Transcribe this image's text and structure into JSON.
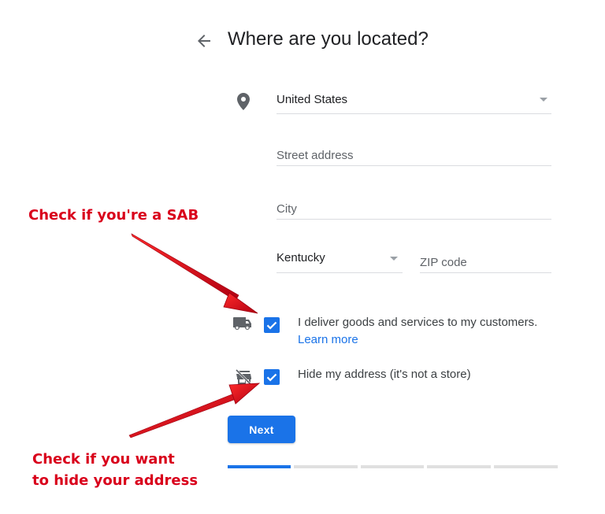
{
  "header": {
    "title": "Where are you located?"
  },
  "form": {
    "country": {
      "value": "United States"
    },
    "street": {
      "placeholder": "Street address"
    },
    "city": {
      "placeholder": "City"
    },
    "state": {
      "value": "Kentucky"
    },
    "zip": {
      "placeholder": "ZIP code"
    },
    "deliver": {
      "label": "I deliver goods and services to my customers.",
      "link": "Learn more",
      "checked": true
    },
    "hide_address": {
      "label": "Hide my address (it's not a store)",
      "checked": true
    },
    "next_label": "Next"
  },
  "progress": {
    "current_step": 1,
    "total_steps": 5
  },
  "annotations": {
    "sab": "Check if you're a SAB",
    "hide_line1": "Check if you want",
    "hide_line2": "to hide your address"
  },
  "colors": {
    "accent": "#1a73e8",
    "annotation": "#d9001b",
    "divider": "#dadce0"
  },
  "icons": {
    "back": "arrow-back-icon",
    "location": "location-pin-icon",
    "delivery": "truck-icon",
    "no_store": "store-off-icon",
    "dropdown": "dropdown-caret-icon",
    "check": "checkmark-icon"
  }
}
